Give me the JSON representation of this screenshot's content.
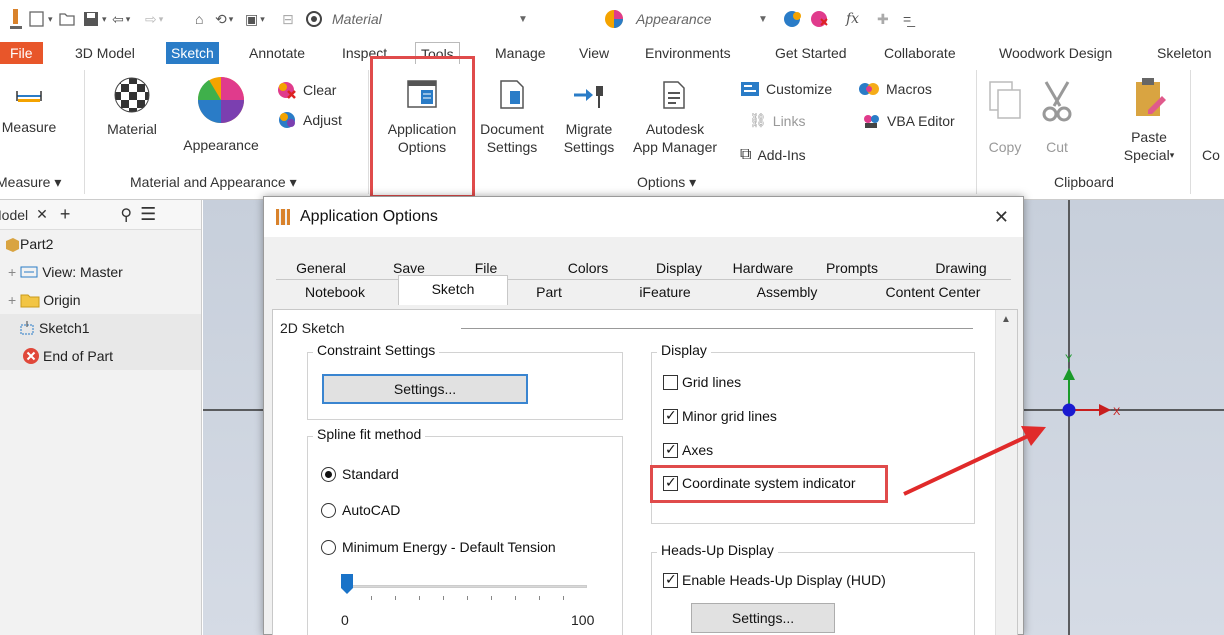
{
  "qat": {
    "material_combo": "Material",
    "appearance_combo": "Appearance"
  },
  "tabs": [
    {
      "label": "File"
    },
    {
      "label": "3D Model"
    },
    {
      "label": "Sketch"
    },
    {
      "label": "Annotate"
    },
    {
      "label": "Inspect"
    },
    {
      "label": "Tools"
    },
    {
      "label": "Manage"
    },
    {
      "label": "View"
    },
    {
      "label": "Environments"
    },
    {
      "label": "Get Started"
    },
    {
      "label": "Collaborate"
    },
    {
      "label": "Woodwork Design"
    },
    {
      "label": "Skeleton"
    }
  ],
  "ribbon": {
    "measure": "Measure",
    "material": "Material",
    "appearance": "Appearance",
    "clear": "Clear",
    "adjust": "Adjust",
    "app_options_1": "Application",
    "app_options_2": "Options",
    "doc_settings_1": "Document",
    "doc_settings_2": "Settings",
    "migrate_1": "Migrate",
    "migrate_2": "Settings",
    "autodesk_1": "Autodesk",
    "autodesk_2": "App Manager",
    "customize": "Customize",
    "macros": "Macros",
    "links": "Links",
    "vba": "VBA Editor",
    "addins": "Add-Ins",
    "copy": "Copy",
    "cut": "Cut",
    "paste_1": "Paste",
    "paste_2": "Special",
    "co": "Co",
    "panel_measure": "Measure",
    "panel_material": "Material and Appearance",
    "panel_options": "Options",
    "panel_clipboard": "Clipboard"
  },
  "browser": {
    "tab": "Model",
    "items": [
      {
        "label": "Part2"
      },
      {
        "label": "View: Master"
      },
      {
        "label": "Origin"
      },
      {
        "label": "Sketch1"
      },
      {
        "label": "End of Part"
      }
    ]
  },
  "canvas": {
    "axis_x": "X",
    "axis_y": "Y"
  },
  "dialog": {
    "title": "Application Options",
    "tabs_row1": [
      "General",
      "Save",
      "File",
      "Colors",
      "Display",
      "Hardware",
      "Prompts",
      "Drawing"
    ],
    "tabs_row2": [
      "Notebook",
      "Sketch",
      "Part",
      "iFeature",
      "Assembly",
      "Content Center"
    ],
    "section": "2D Sketch",
    "constraint_title": "Constraint Settings",
    "settings_btn": "Settings...",
    "spline_title": "Spline fit method",
    "spline_options": [
      "Standard",
      "AutoCAD",
      "Minimum Energy - Default Tension"
    ],
    "spline_selected": 0,
    "slider_min": "0",
    "slider_max": "100",
    "display_title": "Display",
    "display_options": [
      {
        "label": "Grid lines",
        "checked": false
      },
      {
        "label": "Minor grid lines",
        "checked": true
      },
      {
        "label": "Axes",
        "checked": true
      },
      {
        "label": "Coordinate system indicator",
        "checked": true
      }
    ],
    "hud_title": "Heads-Up Display",
    "hud_option": "Enable Heads-Up Display (HUD)",
    "hud_checked": true,
    "hud_settings_btn": "Settings..."
  },
  "colors": {
    "file_tab": "#e8562a",
    "sketch_tab": "#2a7cc7",
    "highlight": "#e04b4b",
    "arrow": "#e02a2a"
  }
}
